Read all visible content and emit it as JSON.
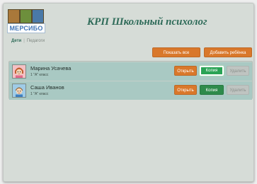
{
  "app": {
    "logo_text": "МЕРСИБО",
    "title": "КРП Школьный психолог"
  },
  "tabs": [
    {
      "label": "Дети",
      "active": true
    },
    {
      "label": "Педагоги",
      "active": false
    }
  ],
  "tab_separator": "|",
  "toolbar": {
    "show_all_label": "Показать все",
    "add_child_label": "Добавить ребёнка"
  },
  "children": [
    {
      "name": "Марина Усачева",
      "class": "1 \"А\" класс",
      "avatar_icon": "girl-avatar-icon",
      "actions": {
        "open": "Открыть",
        "copy": "Копия",
        "delete": "Удалить"
      },
      "copy_highlighted": true
    },
    {
      "name": "Саша Иванов",
      "class": "1 \"А\" класс",
      "avatar_icon": "boy-avatar-icon",
      "actions": {
        "open": "Открыть",
        "copy": "Копия",
        "delete": "Удалить"
      },
      "copy_highlighted": false
    }
  ],
  "colors": {
    "accent_orange": "#d9782b",
    "accent_green": "#2aa355",
    "title_color": "#2f6b59",
    "row_background": "#a9c9c3"
  }
}
